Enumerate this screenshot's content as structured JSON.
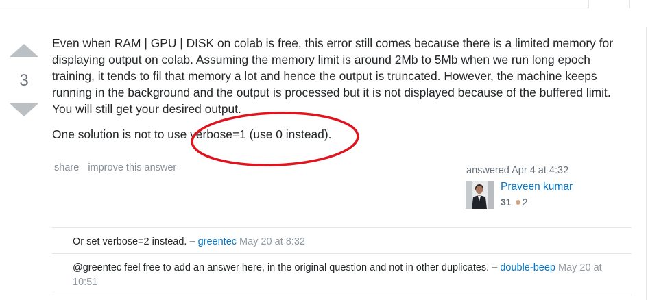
{
  "vote": {
    "count": "3"
  },
  "answer": {
    "paragraphs": [
      "Even when RAM | GPU | DISK on colab is free, this error still comes because there is a limited memory for displaying output on colab. Assuming the memory limit is around 2Mb to 5Mb when we run long epoch training, it tends to fil that memory a lot and hence the output is truncated. However, the machine keeps running in the background and the output is processed but it is not displayed because of the buffered limit. You will still get your desired output.",
      "One solution is not to use verbose=1 (use 0 instead)."
    ]
  },
  "menu": {
    "share_label": "share",
    "improve_label": "improve this answer"
  },
  "user": {
    "action": "answered Apr 4 at 4:32",
    "name": "Praveen kumar",
    "reputation": "31",
    "bronze_badges": "2",
    "avatar_icon": "user-photo"
  },
  "comments": [
    {
      "text": "Or set verbose=2 instead.",
      "sep": " – ",
      "user": "greentec",
      "date": "May 20 at 8:32"
    },
    {
      "text": "@greentec feel free to add an answer here, in the original question and not in other duplicates.",
      "sep": " – ",
      "user": "double-beep",
      "date": "May 20 at 10:51"
    }
  ],
  "colors": {
    "link": "#0077cc",
    "annotation": "#e0141e",
    "vote_arrow": "#bbc0c4",
    "bronze": "#d1a684"
  }
}
